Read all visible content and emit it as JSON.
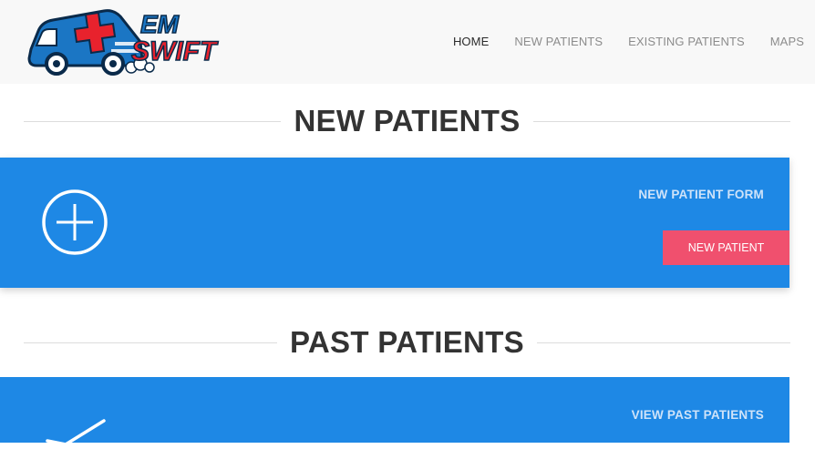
{
  "brand": {
    "line1": "EM",
    "line2": "SWIFT"
  },
  "nav": [
    {
      "label": "HOME",
      "active": true
    },
    {
      "label": "NEW PATIENTS",
      "active": false
    },
    {
      "label": "EXISTING PATIENTS",
      "active": false
    },
    {
      "label": "MAPS",
      "active": false
    }
  ],
  "new_section": {
    "title": "NEW PATIENTS",
    "panel_title": "NEW PATIENT FORM",
    "button_label": "NEW PATIENT",
    "icon": "plus-circle-icon"
  },
  "past_section": {
    "title": "PAST PATIENTS",
    "panel_title": "VIEW PAST PATIENTS",
    "icon": "checkmark-icon"
  },
  "colors": {
    "panel": "#1e88e5",
    "button": "#f0506e",
    "header_bg": "#f8f8f8",
    "logo_red": "#e8222d",
    "logo_blue": "#1b76c4"
  }
}
